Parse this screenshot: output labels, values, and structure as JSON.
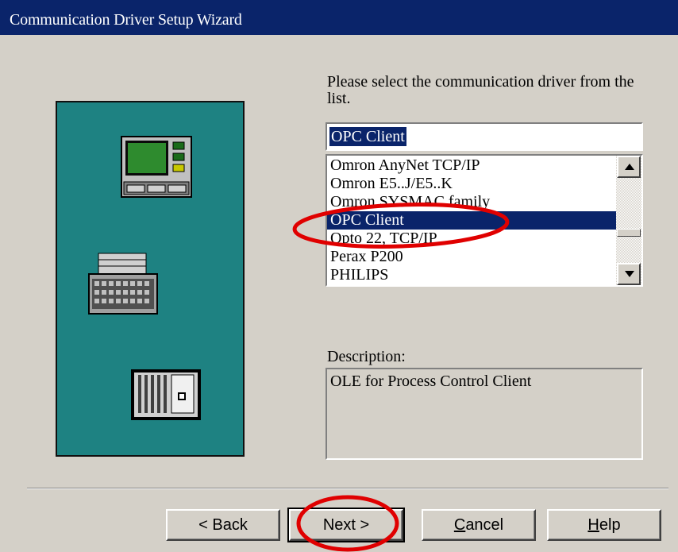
{
  "window": {
    "title": "Communication Driver Setup Wizard"
  },
  "prompt": "Please select the communication driver from the list.",
  "combo": {
    "value": "OPC Client"
  },
  "driver_list": {
    "items": [
      {
        "label": "Omron AnyNet TCP/IP",
        "selected": false
      },
      {
        "label": "Omron E5..J/E5..K",
        "selected": false
      },
      {
        "label": "Omron SYSMAC family",
        "selected": false
      },
      {
        "label": "OPC Client",
        "selected": true
      },
      {
        "label": "Opto 22, TCP/IP",
        "selected": false
      },
      {
        "label": "Perax P200",
        "selected": false
      },
      {
        "label": "PHILIPS",
        "selected": false
      }
    ]
  },
  "description": {
    "label": "Description:",
    "text": "OLE for Process Control Client"
  },
  "buttons": {
    "back": "< Back",
    "next": "Next >",
    "cancel_mnemonic": "C",
    "cancel_rest": "ancel",
    "help_mnemonic": "H",
    "help_rest": "elp"
  },
  "icons": {
    "panel_art": [
      "hmi-terminal-icon",
      "printer-icon",
      "plc-rack-icon"
    ],
    "scroll_up": "scroll-up-arrow-icon",
    "scroll_down": "scroll-down-arrow-icon"
  },
  "colors": {
    "titlebar": "#0a246a",
    "panel": "#1e8282",
    "selection": "#0a246a",
    "annotation": "#e00000"
  }
}
